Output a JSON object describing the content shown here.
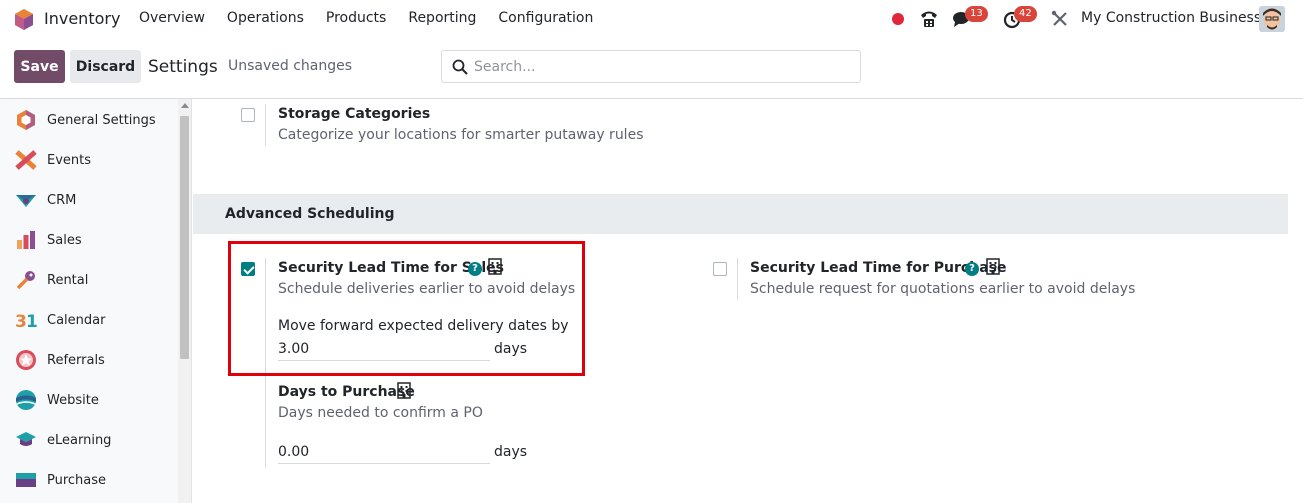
{
  "navbar": {
    "app_name": "Inventory",
    "menu": [
      "Overview",
      "Operations",
      "Products",
      "Reporting",
      "Configuration"
    ],
    "chat_badge": "13",
    "activity_badge": "42",
    "company": "My Construction Business"
  },
  "control_panel": {
    "save_label": "Save",
    "discard_label": "Discard",
    "title": "Settings",
    "unsaved": "Unsaved changes",
    "search_placeholder": "Search..."
  },
  "sidebar": {
    "items": [
      {
        "label": "General Settings",
        "icon": "odoo-hex-icon"
      },
      {
        "label": "Events",
        "icon": "events-icon"
      },
      {
        "label": "CRM",
        "icon": "crm-icon"
      },
      {
        "label": "Sales",
        "icon": "sales-chart-icon"
      },
      {
        "label": "Rental",
        "icon": "rental-key-icon"
      },
      {
        "label": "Calendar",
        "icon": "calendar-31-icon"
      },
      {
        "label": "Referrals",
        "icon": "referrals-icon"
      },
      {
        "label": "Website",
        "icon": "website-icon"
      },
      {
        "label": "eLearning",
        "icon": "elearning-cap-icon"
      },
      {
        "label": "Purchase",
        "icon": "purchase-icon"
      }
    ]
  },
  "main": {
    "storage": {
      "title": "Storage Categories",
      "desc": "Categorize your locations for smarter putaway rules",
      "checked": false
    },
    "section_title": "Advanced Scheduling",
    "sales_lead": {
      "title": "Security Lead Time for Sales",
      "desc": "Schedule deliveries earlier to avoid delays",
      "extra": "Move forward expected delivery dates by",
      "value": "3.00",
      "unit": "days",
      "checked": true
    },
    "purchase_lead": {
      "title": "Security Lead Time for Purchase",
      "desc": "Schedule request for quotations earlier to avoid delays",
      "checked": false
    },
    "days_to_purchase": {
      "title": "Days to Purchase",
      "desc": "Days needed to confirm a PO",
      "value": "0.00",
      "unit": "days"
    }
  },
  "colors": {
    "brand": "#714b67",
    "accent": "#017e84",
    "highlight": "#e0000b"
  }
}
